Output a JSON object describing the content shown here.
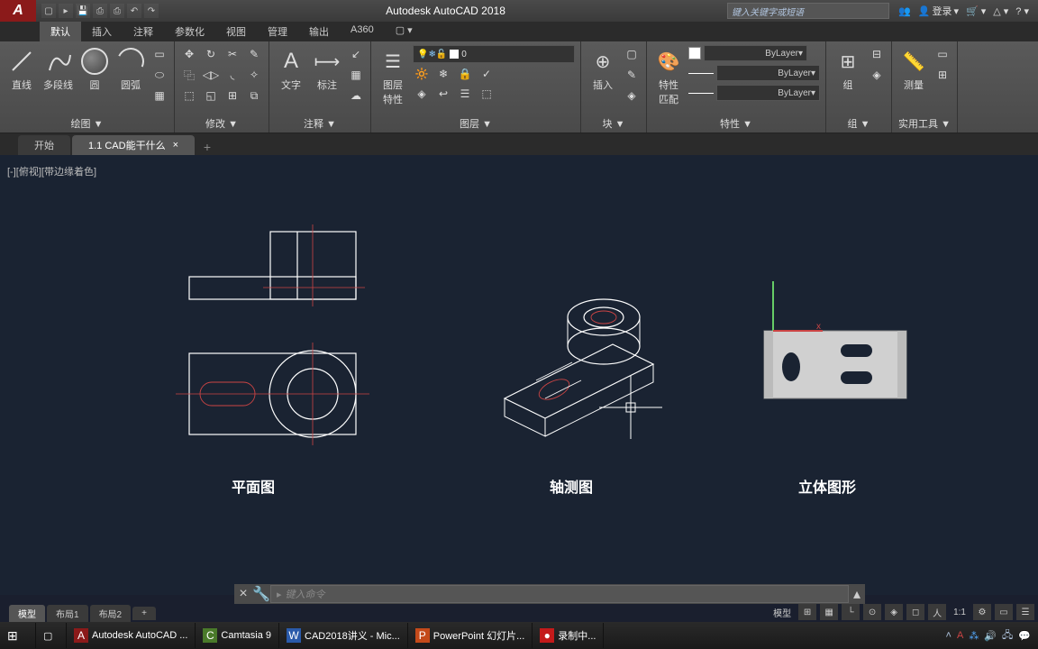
{
  "titlebar": {
    "app_title": "Autodesk AutoCAD 2018",
    "search_placeholder": "键入关键字或短语",
    "login": "登录"
  },
  "menus": {
    "items": [
      "默认",
      "插入",
      "注释",
      "参数化",
      "视图",
      "管理",
      "输出",
      "A360"
    ]
  },
  "ribbon": {
    "draw": {
      "label": "绘图 ▼",
      "line": "直线",
      "polyline": "多段线",
      "circle": "圆",
      "arc": "圆弧"
    },
    "modify": {
      "label": "修改 ▼"
    },
    "annotate": {
      "label": "注释 ▼",
      "text": "文字",
      "dim": "标注"
    },
    "layers": {
      "label": "图层 ▼",
      "props": "图层\n特性",
      "current": "0"
    },
    "block": {
      "label": "块 ▼",
      "insert": "插入"
    },
    "props": {
      "label": "特性 ▼",
      "match": "特性\n匹配",
      "bylayer": "ByLayer"
    },
    "group": {
      "label": "组 ▼",
      "group": "组"
    },
    "utils": {
      "label": "实用工具 ▼",
      "measure": "测量"
    }
  },
  "file_tabs": {
    "start": "开始",
    "active": "1.1 CAD能干什么"
  },
  "view": {
    "label": "[-][俯视][带边缘着色]"
  },
  "drawings": {
    "label1": "平面图",
    "label2": "轴测图",
    "label3": "立体图形"
  },
  "cmdline": {
    "placeholder": "键入命令"
  },
  "layout_tabs": {
    "model": "模型",
    "layout1": "布局1",
    "layout2": "布局2"
  },
  "statusbar": {
    "model": "模型",
    "scale": "1:1"
  },
  "taskbar": {
    "items": [
      {
        "icon": "A",
        "label": "Autodesk AutoCAD ...",
        "color": "#8b1a1a"
      },
      {
        "icon": "C",
        "label": "Camtasia 9",
        "color": "#4a7a2a"
      },
      {
        "icon": "W",
        "label": "CAD2018讲义 - Mic...",
        "color": "#2a5aaa"
      },
      {
        "icon": "P",
        "label": "PowerPoint 幻灯片...",
        "color": "#c44a1a"
      },
      {
        "icon": "●",
        "label": "录制中...",
        "color": "#c41a1a"
      }
    ]
  }
}
